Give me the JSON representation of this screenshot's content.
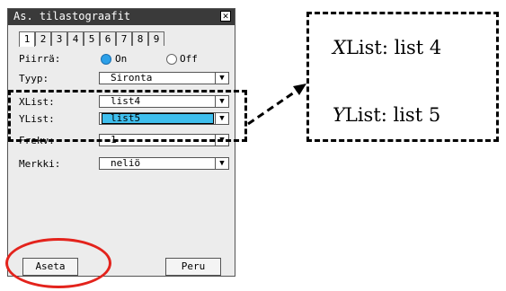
{
  "dialog": {
    "title": "As. tilastograafit",
    "close_glyph": "✕",
    "tabs": [
      "1",
      "2",
      "3",
      "4",
      "5",
      "6",
      "7",
      "8",
      "9"
    ],
    "active_tab": "1",
    "rows": {
      "piirra": {
        "label": "Piirrä:",
        "options": [
          {
            "label": "On",
            "selected": true
          },
          {
            "label": "Off",
            "selected": false
          }
        ]
      },
      "tyyp": {
        "label": "Tyyp:",
        "value": "Sironta"
      },
      "xlist": {
        "label": "XList:",
        "value": "list4"
      },
      "ylist": {
        "label": "YList:",
        "value": "list5"
      },
      "frekv": {
        "label": "Frekv:",
        "value": "1"
      },
      "merkki": {
        "label": "Merkki:",
        "value": "neliö"
      }
    },
    "dropdown_arrow": "▼",
    "buttons": {
      "set": "Aseta",
      "cancel": "Peru"
    }
  },
  "callout": {
    "xlist_prefix": "X",
    "xlist_text": "List: list 4",
    "ylist_prefix": "Y",
    "ylist_text": "List: list 5"
  },
  "colors": {
    "title_bar": "#3a3a3a",
    "radio_on": "#2ca0e8",
    "selection": "#3fbfee",
    "annotation_oval": "#e3231c"
  }
}
